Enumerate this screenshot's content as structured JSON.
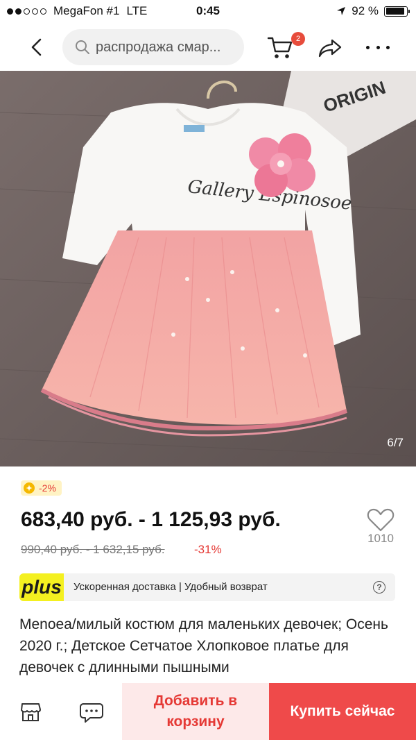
{
  "status_bar": {
    "carrier": "MegaFon #1",
    "network": "LTE",
    "time": "0:45",
    "battery": "92 %",
    "signal_bars": 2,
    "battery_level": 0.92
  },
  "nav": {
    "search_text": "распродажа смар...",
    "cart_count": "2"
  },
  "gallery": {
    "counter": "6/7",
    "shirt_text": "Gallery Espinosoe"
  },
  "price": {
    "discount_badge": "-2%",
    "current": "683,40 руб. - 1 125,93 руб.",
    "old": "990,40 руб. - 1 632,15 руб.",
    "percent_off": "-31%",
    "likes": "1010"
  },
  "plus_banner": {
    "logo": "plus",
    "text": "Ускоренная доставка | Удобный возврат",
    "help": "?"
  },
  "product": {
    "title": "Menoea/милый костюм для маленьких девочек; Осень 2020 г.; Детское Сетчатое Хлопковое платье для девочек с длинными пышными"
  },
  "actions": {
    "add_to_cart": "Добавить в корзину",
    "buy_now": "Купить сейчас"
  },
  "colors": {
    "accent": "#ef4a4a",
    "plus_yellow": "#f4f020"
  }
}
